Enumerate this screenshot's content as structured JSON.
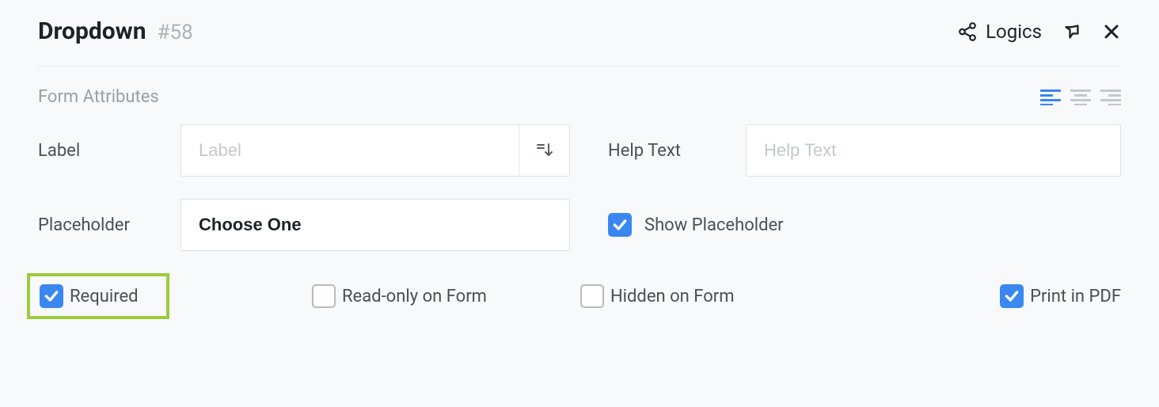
{
  "header": {
    "title": "Dropdown",
    "id": "#58",
    "logics_label": "Logics"
  },
  "section": {
    "title": "Form Attributes"
  },
  "fields": {
    "label": {
      "label": "Label",
      "value": "",
      "placeholder": "Label"
    },
    "help_text": {
      "label": "Help Text",
      "value": "",
      "placeholder": "Help Text"
    },
    "placeholder": {
      "label": "Placeholder",
      "value": "Choose One"
    }
  },
  "checkboxes": {
    "show_placeholder": {
      "label": "Show Placeholder",
      "checked": true
    },
    "required": {
      "label": "Required",
      "checked": true
    },
    "readonly": {
      "label": "Read-only on Form",
      "checked": false
    },
    "hidden": {
      "label": "Hidden on Form",
      "checked": false
    },
    "print_pdf": {
      "label": "Print in PDF",
      "checked": true
    }
  },
  "alignment": {
    "selected": "left"
  }
}
